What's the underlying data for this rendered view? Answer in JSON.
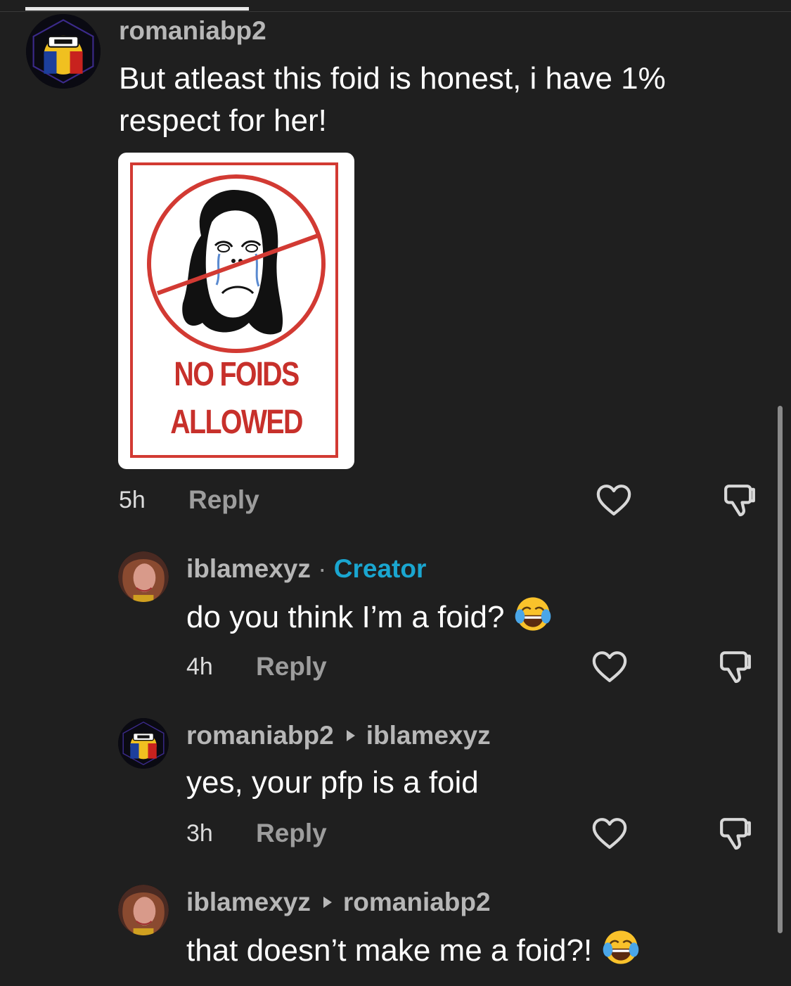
{
  "comments": [
    {
      "username": "romaniabp2",
      "text_line1": "But atleast this foid is honest, i have 1%",
      "text_line2": "respect for her!",
      "image": {
        "line1": "NO FOIDS",
        "line2": "ALLOWED"
      },
      "time": "5h",
      "reply_label": "Reply"
    },
    {
      "username": "iblamexyz",
      "separator": "·",
      "badge": "Creator",
      "text": "do you think I’m a foid?",
      "emoji": "face-with-tears-of-joy",
      "time": "4h",
      "reply_label": "Reply"
    },
    {
      "username": "romaniabp2",
      "reply_to": "iblamexyz",
      "text": "yes, your pfp is a foid",
      "time": "3h",
      "reply_label": "Reply"
    },
    {
      "username": "iblamexyz",
      "reply_to": "romaniabp2",
      "text": "that doesn’t make me a foid?!",
      "emoji": "face-with-tears-of-joy"
    }
  ],
  "colors": {
    "background": "#1f1f1f",
    "creator_badge": "#1aa6d0",
    "username": "#b7b7b7",
    "sign_red": "#d23a33"
  },
  "icons": [
    "heart-icon",
    "dislike-icon",
    "caret-right-icon"
  ]
}
